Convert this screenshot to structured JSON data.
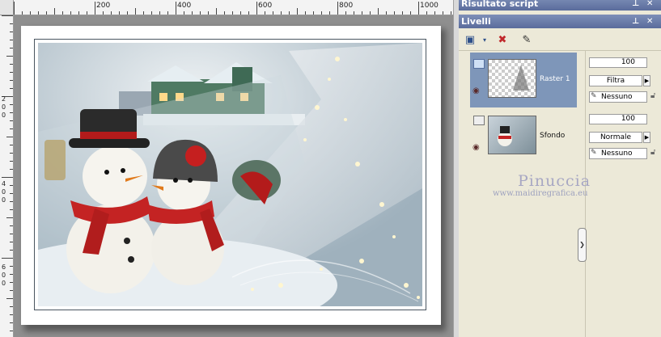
{
  "ruler": {
    "top_labels": [
      "200",
      "400",
      "600",
      "800",
      "1000"
    ],
    "left_labels": [
      "2",
      "0",
      "0",
      "4",
      "0",
      "0",
      "6",
      "0",
      "0"
    ]
  },
  "panels": {
    "script_output": {
      "title": "Risultato script"
    },
    "layers": {
      "title": "Livelli",
      "items": [
        {
          "name": "Raster 1",
          "opacity": "100",
          "blend": "Filtra",
          "mask": "Nessuno",
          "selected": true
        },
        {
          "name": "Sfondo",
          "opacity": "100",
          "blend": "Normale",
          "mask": "Nessuno",
          "selected": false
        }
      ]
    }
  },
  "watermark": {
    "name": "Pinuccia",
    "url": "www.maidiregrafica.eu"
  },
  "icons": [
    "pin-icon",
    "close-icon",
    "new-layer-icon",
    "delete-layer-icon",
    "edit-layer-icon",
    "eye-icon",
    "lock-icon",
    "mask-icon",
    "chevron-right-icon"
  ],
  "colors": {
    "titlebar": "#6676a8",
    "selected_layer": "#7e96b9",
    "panel": "#ece9d8"
  }
}
